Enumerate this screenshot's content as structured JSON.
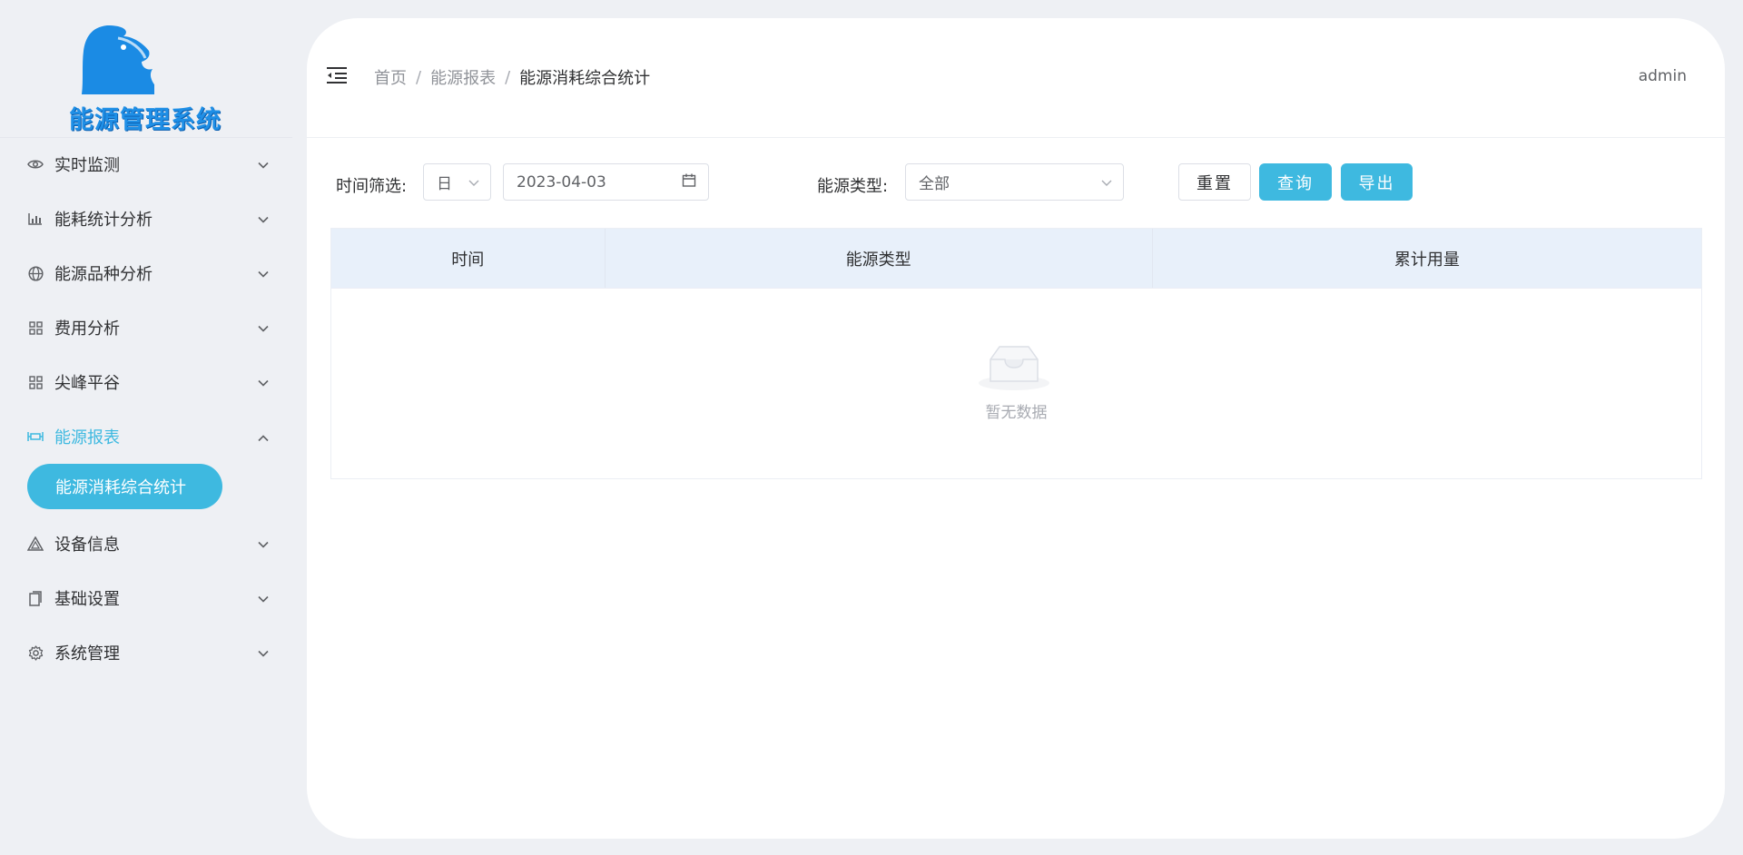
{
  "app": {
    "logo_text": "能源管理系统"
  },
  "sidebar": {
    "items": [
      {
        "label": "实时监测",
        "icon": "eye-icon",
        "expanded": false
      },
      {
        "label": "能耗统计分析",
        "icon": "bar-chart-icon",
        "expanded": false
      },
      {
        "label": "能源品种分析",
        "icon": "globe-icon",
        "expanded": false
      },
      {
        "label": "费用分析",
        "icon": "grid-icon",
        "expanded": false
      },
      {
        "label": "尖峰平谷",
        "icon": "grid-icon",
        "expanded": false
      },
      {
        "label": "能源报表",
        "icon": "report-icon",
        "expanded": true
      },
      {
        "label": "设备信息",
        "icon": "triangle-icon",
        "expanded": false
      },
      {
        "label": "基础设置",
        "icon": "document-icon",
        "expanded": false
      },
      {
        "label": "系统管理",
        "icon": "gear-icon",
        "expanded": false
      }
    ],
    "active_sub_item": "能源消耗综合统计",
    "accent_color": "#3eb9e0"
  },
  "header": {
    "breadcrumb": [
      "首页",
      "能源报表",
      "能源消耗综合统计"
    ],
    "separator": "/",
    "user": "admin"
  },
  "filters": {
    "time_label": "时间筛选:",
    "period_value": "日",
    "date_value": "2023-04-03",
    "energy_type_label": "能源类型:",
    "energy_type_value": "全部",
    "reset_label": "重置",
    "query_label": "查询",
    "export_label": "导出"
  },
  "table": {
    "columns": [
      "时间",
      "能源类型",
      "累计用量"
    ],
    "rows": [],
    "empty_text": "暂无数据"
  }
}
